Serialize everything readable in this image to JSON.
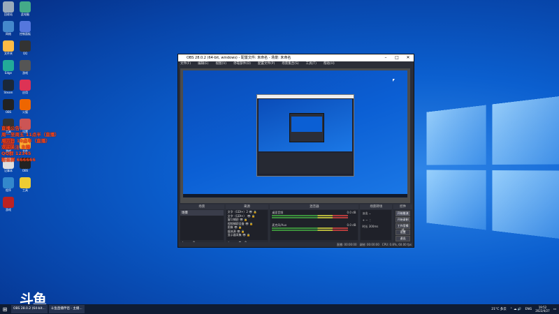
{
  "desktop": {
    "overlay_lines": [
      "直播公告：",
      "周一至周五 11点半（直播）",
      "周六日 10点半（直播）",
      "欢迎关注 主播",
      "QQ群 12345",
      "粉丝群 666666"
    ],
    "brand_mark": "斗鱼",
    "icons": [
      {
        "label": "回收站",
        "color": "#9ab"
      },
      {
        "label": "此电脑",
        "color": "#4a8"
      },
      {
        "label": "网络",
        "color": "#48c"
      },
      {
        "label": "控制面板",
        "color": "#57d"
      },
      {
        "label": "文件夹",
        "color": "#fb4"
      },
      {
        "label": "QQ",
        "color": "#333"
      },
      {
        "label": "Edge",
        "color": "#2a9"
      },
      {
        "label": "游戏",
        "color": "#555"
      },
      {
        "label": "Steam",
        "color": "#1b2838"
      },
      {
        "label": "应用",
        "color": "#d35"
      },
      {
        "label": "OBS",
        "color": "#222"
      },
      {
        "label": "火狐",
        "color": "#e60"
      },
      {
        "label": "工具",
        "color": "#333"
      },
      {
        "label": "设置",
        "color": "#c55"
      },
      {
        "label": "游戏",
        "color": "#a33"
      },
      {
        "label": "文件",
        "color": "#fa3"
      },
      {
        "label": "记事本",
        "color": "#ddd"
      },
      {
        "label": "OBS",
        "color": "#222"
      },
      {
        "label": "程序",
        "color": "#38c"
      },
      {
        "label": "工具",
        "color": "#ec3"
      },
      {
        "label": "游戏",
        "color": "#b22"
      }
    ]
  },
  "obs": {
    "title": "OBS 28.0.2 (64-bit, windows) - 配置文件: 未命名 - 场景: 未命名",
    "menu": [
      "文件(F)",
      "编辑(E)",
      "视图(V)",
      "停靠部件(D)",
      "配置文件(P)",
      "场景集合(S)",
      "工具(T)",
      "帮助(H)"
    ],
    "docks": {
      "scenes": {
        "header": "场景",
        "items": [
          "场景"
        ]
      },
      "sources": {
        "header": "来源",
        "items": [
          "文字（GDI+）2",
          "文字（GDI+）",
          "窗口捕获",
          "视频捕获设备",
          "图像",
          "媒体源",
          "显示器采集"
        ]
      },
      "mixer": {
        "header": "混音器",
        "rows": [
          {
            "name": "桌面音频",
            "db": "0.0 dB"
          },
          {
            "name": "麦克风/Aux",
            "db": "0.0 dB"
          }
        ]
      },
      "transitions": {
        "header": "场景转场",
        "type": "淡出",
        "duration_label": "时长",
        "duration": "300ms"
      },
      "controls": {
        "header": "控件",
        "buttons": [
          "开始推流",
          "开始录制",
          "工作室模式",
          "设置",
          "退出"
        ]
      }
    },
    "status": {
      "live_label": "直播:",
      "live_time": "00:00:00",
      "rec_label": "录制:",
      "rec_time": "00:00:00",
      "cpu": "CPU: 0.8%, 60.00 fps"
    }
  },
  "taskbar": {
    "apps": [
      "OBS 28.0.2 (64-bit...",
      "斗鱼直播伴侣 - 主播..."
    ],
    "weather": "21°C 多云",
    "lang": "ENG",
    "time": "19:52",
    "date": "2022/4/27"
  }
}
